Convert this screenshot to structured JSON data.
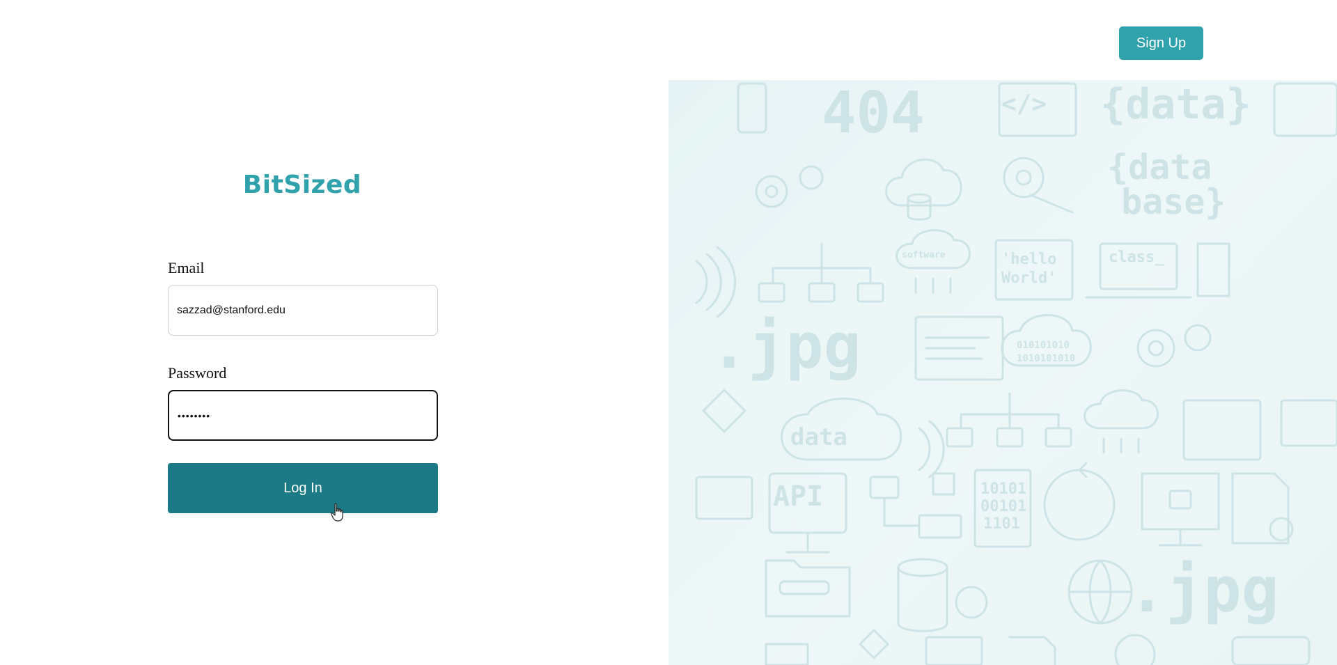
{
  "header": {
    "signup_label": "Sign Up"
  },
  "brand": {
    "name": "BitSized",
    "color": "#30a2ab"
  },
  "login_form": {
    "email_label": "Email",
    "email_value": "sazzad@stanford.edu",
    "password_label": "Password",
    "password_value": "••••••••",
    "login_label": "Log In",
    "login_color": "#1b7a86"
  },
  "illustration": {
    "doodles": [
      "404",
      "</>",
      "{data}",
      "{data",
      "base}",
      ".jpg",
      "'hello",
      "World'",
      "class_",
      "software",
      "data",
      "API",
      "10101",
      "00101",
      "1101",
      "010101010",
      "1010101010"
    ]
  },
  "colors": {
    "accent": "#30a2ab",
    "primary_button": "#1b7a86",
    "pattern_bg": "#e6f3f4",
    "pattern_ink": "#cde3e5"
  }
}
